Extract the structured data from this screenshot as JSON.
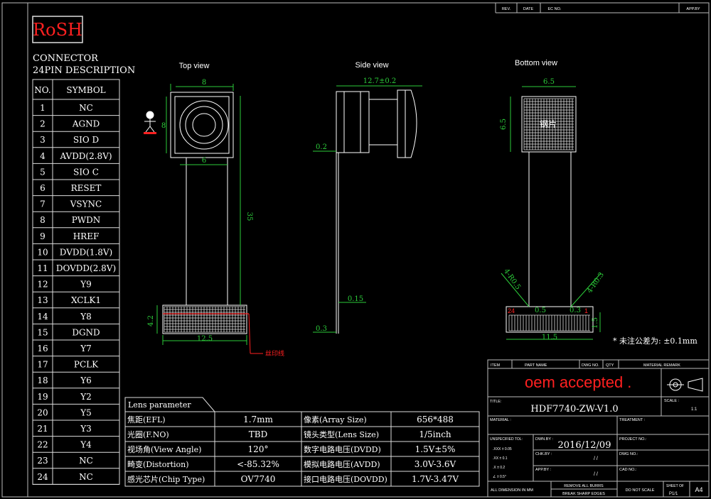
{
  "logo": "RoSH",
  "connector": {
    "title_line1": "CONNECTOR",
    "title_line2": "24PIN DESCRIPTION",
    "col_no": "NO.",
    "col_symbol": "SYMBOL",
    "pins": [
      {
        "no": "1",
        "symbol": "NC"
      },
      {
        "no": "2",
        "symbol": "AGND"
      },
      {
        "no": "3",
        "symbol": "SIO D"
      },
      {
        "no": "4",
        "symbol": "AVDD(2.8V)"
      },
      {
        "no": "5",
        "symbol": "SIO C"
      },
      {
        "no": "6",
        "symbol": "RESET"
      },
      {
        "no": "7",
        "symbol": "VSYNC"
      },
      {
        "no": "8",
        "symbol": "PWDN"
      },
      {
        "no": "9",
        "symbol": "HREF"
      },
      {
        "no": "10",
        "symbol": "DVDD(1.8V)"
      },
      {
        "no": "11",
        "symbol": "DOVDD(2.8V)"
      },
      {
        "no": "12",
        "symbol": "Y9"
      },
      {
        "no": "13",
        "symbol": "XCLK1"
      },
      {
        "no": "14",
        "symbol": "Y8"
      },
      {
        "no": "15",
        "symbol": "DGND"
      },
      {
        "no": "16",
        "symbol": "Y7"
      },
      {
        "no": "17",
        "symbol": "PCLK"
      },
      {
        "no": "18",
        "symbol": "Y6"
      },
      {
        "no": "19",
        "symbol": "Y2"
      },
      {
        "no": "20",
        "symbol": "Y5"
      },
      {
        "no": "21",
        "symbol": "Y3"
      },
      {
        "no": "22",
        "symbol": "Y4"
      },
      {
        "no": "23",
        "symbol": "NC"
      },
      {
        "no": "24",
        "symbol": "NC"
      }
    ]
  },
  "views": {
    "top": "Top view",
    "side": "Side view",
    "bottom": "Bottom view"
  },
  "dimensions": {
    "top_width": "8",
    "top_height": "8",
    "top_inner": "6",
    "top_length": "35",
    "top_conn_w": "12.5",
    "top_conn_h": "4.2",
    "top_note": "丝印线",
    "side_width": "12.7±0.2",
    "side_thick": "0.2",
    "side_015": "0.15",
    "side_03": "0.3",
    "bottom_w": "6.5",
    "bottom_h": "6.5",
    "bottom_label": "钢片",
    "bottom_angle_l": "4-R0.5",
    "bottom_angle_r": "4-R0.3",
    "bottom_pin24": "24",
    "bottom_pin1": "1",
    "bottom_pitch": "0.5",
    "bottom_03": "0.3",
    "bottom_conn_w": "11.5",
    "bottom_conn_h": "1.5"
  },
  "tolerance_note": "* 未注公差为: ±0.1mm",
  "lens": {
    "header": "Lens parameter",
    "rows": [
      {
        "k1": "焦距(EFL)",
        "v1": "1.7mm",
        "k2": "像素(Array Size)",
        "v2": "656*488"
      },
      {
        "k1": "光圈(F.NO)",
        "v1": "TBD",
        "k2": "镜头类型(Lens Size)",
        "v2": "1/5inch"
      },
      {
        "k1": "视场角(View Angle)",
        "v1": "120°",
        "k2": "数字电路电压(DVDD)",
        "v2": "1.5V±5%"
      },
      {
        "k1": "畸变(Distortion)",
        "v1": "<-85.32%",
        "k2": "模拟电路电压(AVDD)",
        "v2": "3.0V-3.6V"
      },
      {
        "k1": "感光芯片(Chip Type)",
        "v1": "OV7740",
        "k2": "接口电路电压(DOVDD)",
        "v2": "1.7V-3.47V"
      }
    ]
  },
  "title_block": {
    "rev_headers": [
      "REV.",
      "DATE",
      "EC NO.",
      "APP.BY"
    ],
    "item_headers": [
      "ITEM",
      "PART NAME",
      "DWG NO.",
      "QTY",
      "MATERIAL REMARK"
    ],
    "banner": "oem accepted .",
    "title_label": "TITLE:",
    "title": "HDF7740-ZW-V1.0",
    "scale_label": "SCALE :",
    "scale": "1:1",
    "material_label": "MATERIAL :",
    "treatment_label": "TREATMENT :",
    "unspecified_tol": "UNSPECIFIED TOL:",
    "tol_rows": [
      ".XXX ± 0.05",
      ".XX ± 0.1",
      ".X ± 0.2",
      "∠ ± 0.5°"
    ],
    "dwn_label": "DWN.BY :",
    "date": "2016/12/09",
    "project_label": "PROJECT NO.:",
    "chk_label": "CHK.BY :",
    "chk_value": "/ /",
    "dwg_label": "DWG NO.:",
    "app_label": "APP.BY :",
    "app_value": "/ /",
    "cad_label": "CAD NO.:",
    "all_dim": "ALL DIMENSION IN MM",
    "burrs1": "REMOVE ALL BURRS",
    "burrs2": "BREAK SHARP EDGES",
    "no_scale": "DO NOT SCALE",
    "sheet_label": "SHEET OF",
    "sheet": "P1/1",
    "size": "A4"
  }
}
